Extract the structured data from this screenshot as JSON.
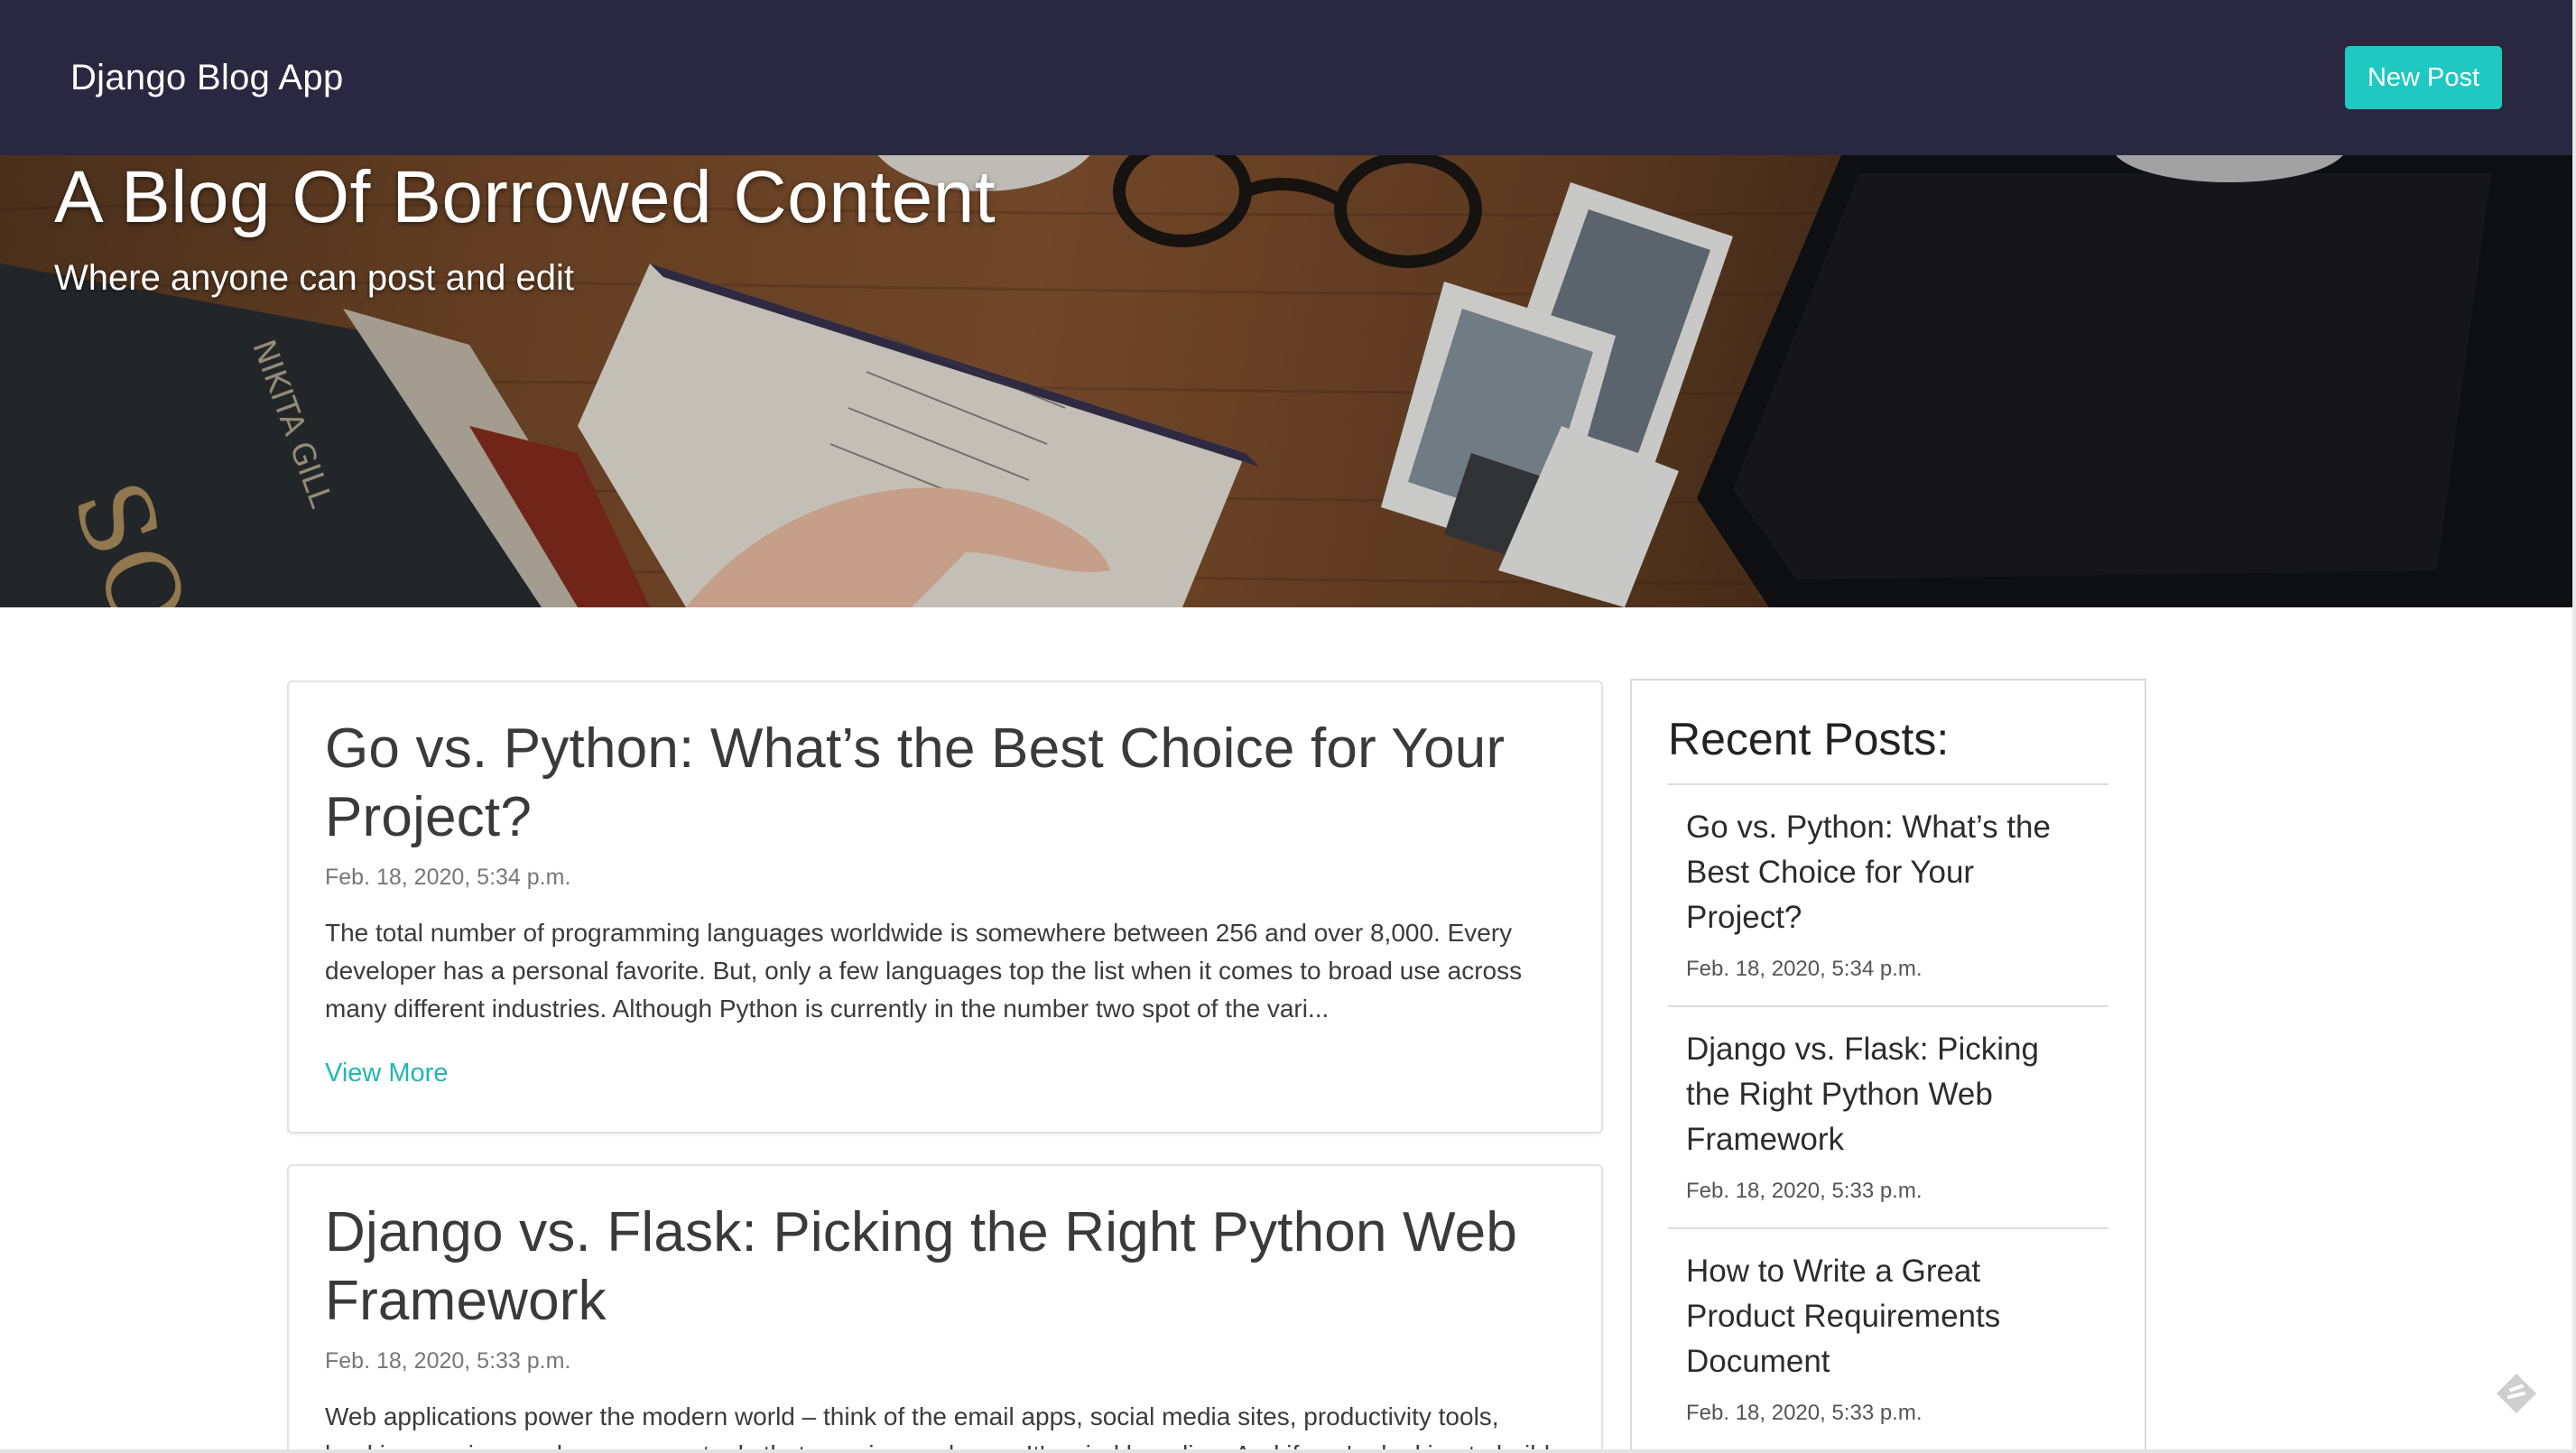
{
  "navbar": {
    "brand": "Django Blog App",
    "new_post_label": "New Post"
  },
  "hero": {
    "title": "A Blog Of Borrowed Content",
    "subtitle": "Where anyone can post and edit"
  },
  "posts": [
    {
      "title": "Go vs. Python: What’s the Best Choice for Your Project?",
      "date": "Feb. 18, 2020, 5:34 p.m.",
      "excerpt": "The total number of programming languages worldwide is somewhere between 256 and over 8,000. Every developer has a personal favorite. But, only a few languages top the list when it comes to broad use across many different industries. Although Python is currently in the number two spot of the vari...",
      "link_label": "View More"
    },
    {
      "title": "Django vs. Flask: Picking the Right Python Web Framework",
      "date": "Feb. 18, 2020, 5:33 p.m.",
      "excerpt": "Web applications power the modern world – think of the email apps, social media sites, productivity tools, banking services and many more tools that run via a web app. It's mind boggling. And if you're looking to build"
    }
  ],
  "sidebar": {
    "title": "Recent Posts:",
    "items": [
      {
        "title": "Go vs. Python: What’s the Best Choice for Your Project?",
        "date": "Feb. 18, 2020, 5:34 p.m."
      },
      {
        "title": "Django vs. Flask: Picking the Right Python Web Framework",
        "date": "Feb. 18, 2020, 5:33 p.m."
      },
      {
        "title": "How to Write a Great Product Requirements Document",
        "date": "Feb. 18, 2020, 5:33 p.m."
      }
    ]
  },
  "colors": {
    "navbar_bg": "#2a2740",
    "accent": "#1fc8c0",
    "link": "#1fb8b0"
  },
  "icons": {
    "hero_background": "desk-photo-image",
    "corner": "tag-icon"
  }
}
